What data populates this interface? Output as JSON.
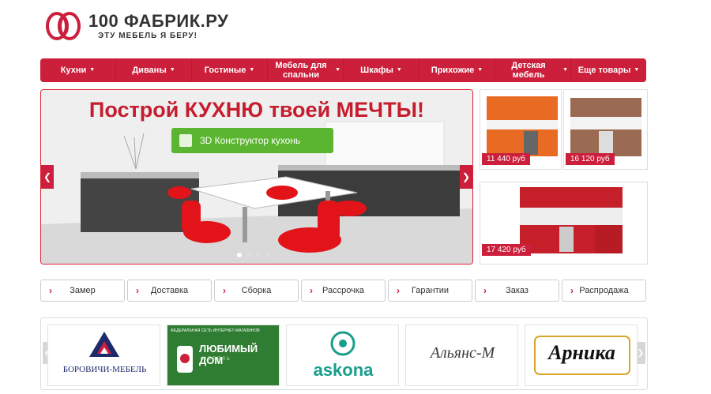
{
  "logo": {
    "title": "100 ФАБРИК.РУ",
    "tagline": "ЭТУ МЕБЕЛЬ Я БЕРУ!",
    "brand_color": "#cc1f3b"
  },
  "nav": {
    "items": [
      {
        "label": "Кухни"
      },
      {
        "label": "Диваны"
      },
      {
        "label": "Гостиные"
      },
      {
        "label": "Мебель для спальни"
      },
      {
        "label": "Шкафы"
      },
      {
        "label": "Прихожие"
      },
      {
        "label": "Детская мебель"
      },
      {
        "label": "Еще товары"
      }
    ]
  },
  "hero": {
    "title": "Построй КУХНЮ твоей МЕЧТЫ!",
    "button_label": "3D Конструктор кухонь",
    "prev_icon": "chevron-left-icon",
    "next_icon": "chevron-right-icon",
    "slides_count": 4,
    "active_slide": 1
  },
  "products": [
    {
      "price": "11 440 руб",
      "color": "#e86a23"
    },
    {
      "price": "16 120 руб",
      "color": "#9a6a52"
    },
    {
      "price": "17 420 руб",
      "color": "#c5202a"
    }
  ],
  "services": {
    "tabs": [
      {
        "label": "Замер"
      },
      {
        "label": "Доставка"
      },
      {
        "label": "Сборка"
      },
      {
        "label": "Рассрочка"
      },
      {
        "label": "Гарантии"
      },
      {
        "label": "Заказ"
      },
      {
        "label": "Распродажа"
      }
    ]
  },
  "brands": {
    "items": [
      {
        "name": "БОРОВИЧИ-МЕБЕЛЬ"
      },
      {
        "name": "ЛЮБИМЫЙ ДОМ",
        "subtitle": "ФЕДЕРАЛЬНАЯ СЕТЬ ИНТЕРНЕТ-МАГАЗИНОВ",
        "sub2": "МЕБЕЛЬ"
      },
      {
        "name": "askona"
      },
      {
        "name": "Альянс-М"
      },
      {
        "name": "Арника"
      }
    ]
  }
}
